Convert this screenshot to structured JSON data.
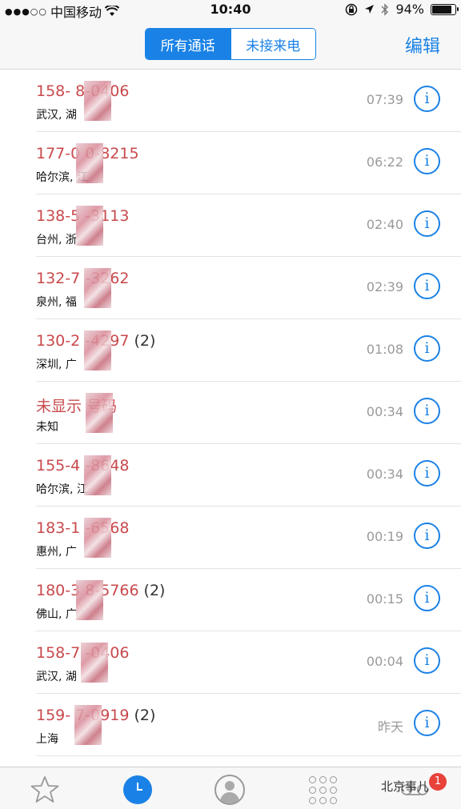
{
  "status_bar": {
    "signal": "●●●○○",
    "carrier": "中国移动",
    "time": "10:40",
    "battery_percent": "94%",
    "battery_level": 0.94
  },
  "nav": {
    "segments": [
      "所有通话",
      "未接来电"
    ],
    "active_segment": 0,
    "edit_label": "编辑"
  },
  "calls": [
    {
      "number": "158-  8-0406",
      "count": "",
      "location": "武汉, 湖",
      "time": "07:39"
    },
    {
      "number": "177-0  0-8215",
      "count": "",
      "location": "哈尔滨,  江",
      "time": "06:22"
    },
    {
      "number": "138-5   -3113",
      "count": "",
      "location": "台州, 浙",
      "time": "02:40"
    },
    {
      "number": "132-7   -3262",
      "count": "",
      "location": "泉州, 福",
      "time": "02:39"
    },
    {
      "number": "130-2   -4297",
      "count": "(2)",
      "location": "深圳, 广",
      "time": "01:08"
    },
    {
      "number": "未显示   号码",
      "count": "",
      "location": "未知",
      "time": "00:34"
    },
    {
      "number": "155-4   -8648",
      "count": "",
      "location": "哈尔滨,  江",
      "time": "00:34"
    },
    {
      "number": "183-1   -6568",
      "count": "",
      "location": "惠州, 广",
      "time": "00:19"
    },
    {
      "number": "180-3  8-5766",
      "count": "(2)",
      "location": "佛山, 广",
      "time": "00:15"
    },
    {
      "number": "158-7   -0406",
      "count": "",
      "location": "武汉, 湖",
      "time": "00:04"
    },
    {
      "number": "159-   7-0919",
      "count": "(2)",
      "location": "上海",
      "time": "昨天"
    }
  ],
  "tab_bar": {
    "tabs": [
      "favorites-tab",
      "recents-tab",
      "contacts-tab",
      "keypad-tab",
      "voicemail-tab"
    ],
    "voicemail_badge": "1",
    "watermark": "北京事儿"
  },
  "colors": {
    "accent": "#1a82e6",
    "missed_call": "#c9494c",
    "badge": "#e8423a"
  }
}
